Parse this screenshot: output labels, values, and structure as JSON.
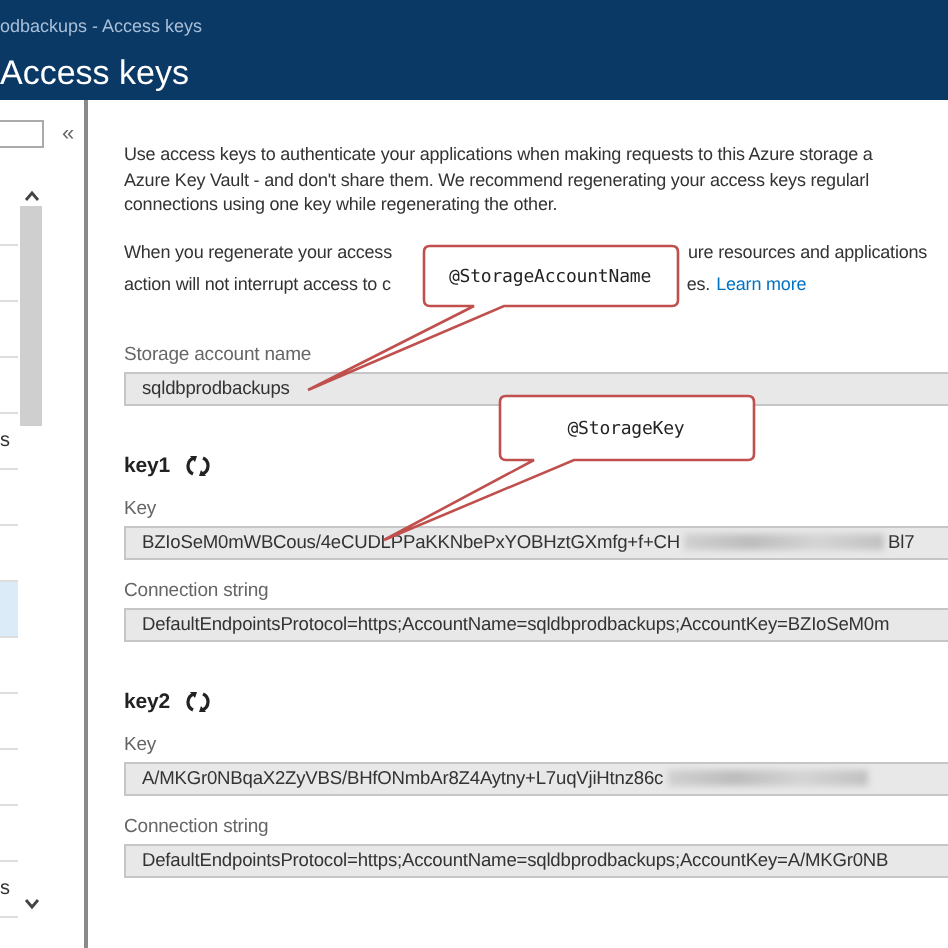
{
  "window": {
    "breadcrumb": "odbackups - Access keys",
    "title": "Access keys"
  },
  "sidebar": {
    "collapse_glyph": "«",
    "items": [
      {
        "selected": false
      },
      {
        "selected": false
      },
      {
        "selected": false
      },
      {
        "selected": false
      },
      {
        "label": "s",
        "selected": false
      },
      {
        "selected": false
      },
      {
        "selected": false
      },
      {
        "selected": true
      },
      {
        "selected": false
      },
      {
        "selected": false
      },
      {
        "selected": false
      },
      {
        "selected": false
      },
      {
        "label": "s",
        "selected": false
      }
    ]
  },
  "intro_lines": [
    "Use access keys to authenticate your applications when making requests to this Azure storage a",
    "Azure Key Vault - and don't share them. We recommend regenerating your access keys regularl",
    "connections using one key while regenerating the other."
  ],
  "regen_note": {
    "line_1_start": "When you regenerate your access",
    "line_1_end": "ure resources and applications",
    "line_2_start": "action will not interrupt access to c",
    "line_2_end": "es.",
    "link": "Learn more"
  },
  "callouts": [
    {
      "text": "@StorageAccountName"
    },
    {
      "text": "@StorageKey"
    }
  ],
  "account_name": {
    "label": "Storage account name",
    "value": "sqldbprodbackups"
  },
  "keys": [
    {
      "name": "key1",
      "fields": [
        {
          "label": "Key",
          "value": "BZIoSeM0mWBCous/4eCUDLPPaKKNbePxYOBHztGXmfg+f+CH",
          "redacted": true,
          "value_end": "Bl7"
        },
        {
          "label": "Connection string",
          "value": "DefaultEndpointsProtocol=https;AccountName=sqldbprodbackups;AccountKey=BZIoSeM0m",
          "redacted": false
        }
      ]
    },
    {
      "name": "key2",
      "fields": [
        {
          "label": "Key",
          "value": "A/MKGr0NBqaX2ZyVBS/BHfONmbAr8Z4Aytny+L7uqVjiHtnz86c",
          "redacted": true
        },
        {
          "label": "Connection string",
          "value": "DefaultEndpointsProtocol=https;AccountName=sqldbprodbackups;AccountKey=A/MKGr0NB",
          "redacted": false
        }
      ]
    }
  ]
}
